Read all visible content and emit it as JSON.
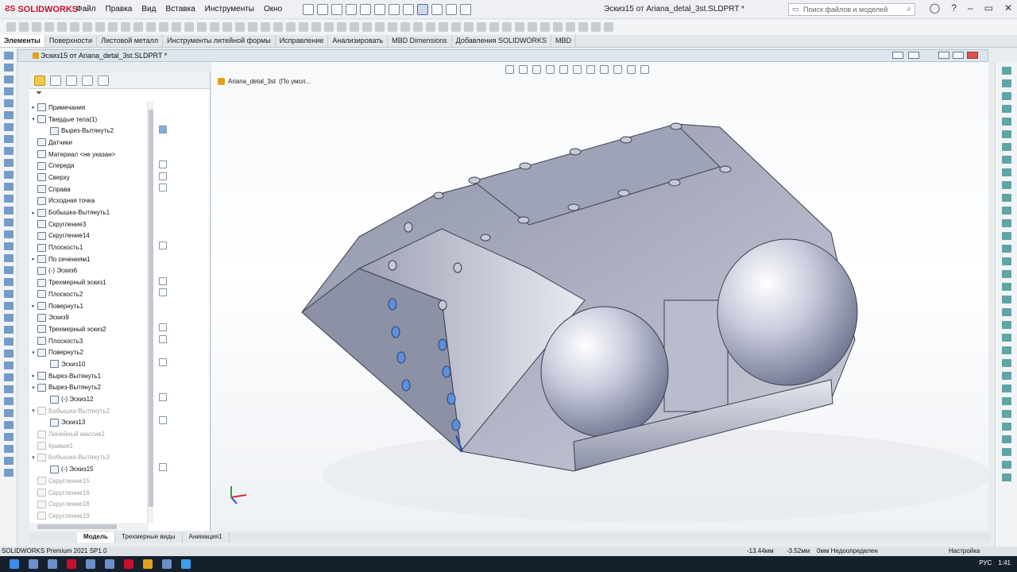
{
  "app": {
    "brand": "SOLIDWORKS",
    "document_title": "Эскиз15 от Ariana_detal_3st.SLDPRT *"
  },
  "menu": [
    "Файл",
    "Правка",
    "Вид",
    "Вставка",
    "Инструменты",
    "Окно"
  ],
  "search": {
    "placeholder": "Поиск файлов и моделей"
  },
  "command_tabs": [
    "Элементы",
    "Поверхности",
    "Листовой металл",
    "Инструменты литейной формы",
    "Исправление",
    "Анализировать",
    "MBD Dimensions",
    "Добавления SOLIDWORKS",
    "MBD"
  ],
  "doc_tab": {
    "label": "Эскиз15 от Ariana_detal_3st.SLDPRT *"
  },
  "breadcrumb": {
    "part": "Ariana_detal_3st",
    "config": "(По умол..."
  },
  "tree": [
    {
      "label": "Примечания",
      "arrow": "▸",
      "dim": false,
      "indent": 0
    },
    {
      "label": "Твердые тела(1)",
      "arrow": "▾",
      "dim": false,
      "indent": 0
    },
    {
      "label": "Вырез-Вытянуть2",
      "arrow": "",
      "dim": false,
      "indent": 1
    },
    {
      "label": "Датчики",
      "arrow": "",
      "dim": false,
      "indent": 0
    },
    {
      "label": "Материал <не указан>",
      "arrow": "",
      "dim": false,
      "indent": 0
    },
    {
      "label": "Спереди",
      "arrow": "",
      "dim": false,
      "indent": 0
    },
    {
      "label": "Сверху",
      "arrow": "",
      "dim": false,
      "indent": 0
    },
    {
      "label": "Справа",
      "arrow": "",
      "dim": false,
      "indent": 0
    },
    {
      "label": "Исходная точка",
      "arrow": "",
      "dim": false,
      "indent": 0
    },
    {
      "label": "Бобышка-Вытянуть1",
      "arrow": "▸",
      "dim": false,
      "indent": 0
    },
    {
      "label": "Скругление3",
      "arrow": "",
      "dim": false,
      "indent": 0
    },
    {
      "label": "Скругление14",
      "arrow": "",
      "dim": false,
      "indent": 0
    },
    {
      "label": "Плоскость1",
      "arrow": "",
      "dim": false,
      "indent": 0
    },
    {
      "label": "По сечениям1",
      "arrow": "▸",
      "dim": false,
      "indent": 0
    },
    {
      "label": "(-) Эскиз6",
      "arrow": "",
      "dim": false,
      "indent": 0
    },
    {
      "label": "Трехмерный эскиз1",
      "arrow": "",
      "dim": false,
      "indent": 0
    },
    {
      "label": "Плоскость2",
      "arrow": "",
      "dim": false,
      "indent": 0
    },
    {
      "label": "Повернуть1",
      "arrow": "▸",
      "dim": false,
      "indent": 0
    },
    {
      "label": "Эскиз9",
      "arrow": "",
      "dim": false,
      "indent": 0
    },
    {
      "label": "Трехмерный эскиз2",
      "arrow": "",
      "dim": false,
      "indent": 0
    },
    {
      "label": "Плоскость3",
      "arrow": "",
      "dim": false,
      "indent": 0
    },
    {
      "label": "Повернуть2",
      "arrow": "▾",
      "dim": false,
      "indent": 0
    },
    {
      "label": "Эскиз10",
      "arrow": "",
      "dim": false,
      "indent": 1
    },
    {
      "label": "Вырез-Вытянуть1",
      "arrow": "▸",
      "dim": false,
      "indent": 0
    },
    {
      "label": "Вырез-Вытянуть2",
      "arrow": "▾",
      "dim": false,
      "indent": 0
    },
    {
      "label": "(-) Эскиз12",
      "arrow": "",
      "dim": false,
      "indent": 1
    },
    {
      "label": "Бобышка-Вытянуть2",
      "arrow": "▾",
      "dim": true,
      "indent": 0
    },
    {
      "label": "Эскиз13",
      "arrow": "",
      "dim": false,
      "indent": 1
    },
    {
      "label": "Линейный массив1",
      "arrow": "",
      "dim": true,
      "indent": 0
    },
    {
      "label": "Кривая1",
      "arrow": "",
      "dim": true,
      "indent": 0
    },
    {
      "label": "Бобышка-Вытянуть3",
      "arrow": "▾",
      "dim": true,
      "indent": 0
    },
    {
      "label": "(-) Эскиз15",
      "arrow": "",
      "dim": false,
      "indent": 1
    },
    {
      "label": "Скругление15",
      "arrow": "",
      "dim": true,
      "indent": 0
    },
    {
      "label": "Скругление16",
      "arrow": "",
      "dim": true,
      "indent": 0
    },
    {
      "label": "Скругление18",
      "arrow": "",
      "dim": true,
      "indent": 0
    },
    {
      "label": "Скругление19",
      "arrow": "",
      "dim": true,
      "indent": 0
    }
  ],
  "bottom_tabs": [
    "Модель",
    "Трехмерные виды",
    "Анимация1"
  ],
  "status": {
    "product": "SOLIDWORKS Premium 2021 SP1.0",
    "x": "-13.44мм",
    "y": "-3.52мм",
    "z": "0мм Недоопределен",
    "custom": "Настройка"
  },
  "taskbar": {
    "lang": "РУС",
    "time": "1:41"
  }
}
